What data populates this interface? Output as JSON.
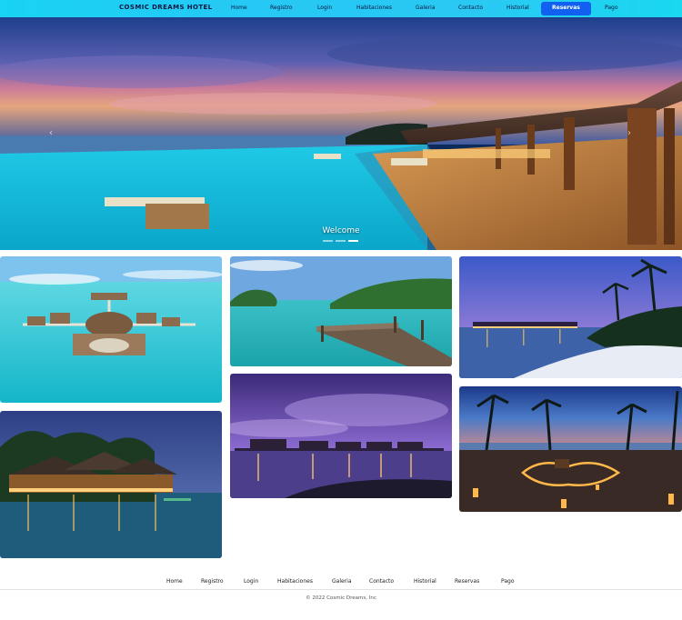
{
  "navbar": {
    "brand": "COSMIC DREAMS HOTEL",
    "items": [
      {
        "label": "Home",
        "active": false
      },
      {
        "label": "Registro",
        "active": false
      },
      {
        "label": "Login",
        "active": false
      },
      {
        "label": "Habitaciones",
        "active": false
      },
      {
        "label": "Galeria",
        "active": false
      },
      {
        "label": "Contacto",
        "active": false
      },
      {
        "label": "Historial",
        "active": false
      },
      {
        "label": "Reservas",
        "active": true
      },
      {
        "label": "Pago",
        "active": false
      }
    ],
    "colors": {
      "bar": "#22cdf2",
      "active": "#1160f0",
      "text": "#0b1640"
    }
  },
  "hero": {
    "caption": "Welcome",
    "slides": 3,
    "active_slide": 2,
    "prev_icon": "chevron-left-icon",
    "next_icon": "chevron-right-icon"
  },
  "gallery": {
    "images": [
      {
        "subject": "overwater-villas-aerial"
      },
      {
        "subject": "tropical-pier"
      },
      {
        "subject": "beach-dusk-bungalows"
      },
      {
        "subject": "night-villa-lights"
      },
      {
        "subject": "purple-sunset-bungalows"
      },
      {
        "subject": "candle-heart-beach"
      }
    ]
  },
  "footer": {
    "items": [
      "Home",
      "Registro",
      "Login",
      "Habitaciones",
      "Galeria",
      "Contacto",
      "Historial",
      "Reservas",
      "Pago"
    ],
    "copyright": "© 2022 Cosmic Dreams, Inc"
  }
}
